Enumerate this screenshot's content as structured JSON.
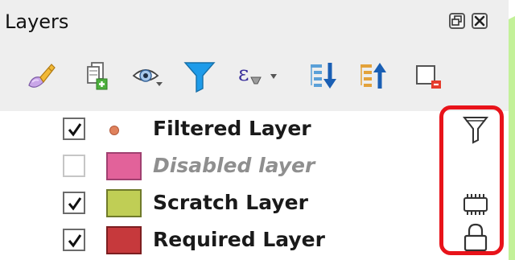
{
  "panel": {
    "title": "Layers",
    "title_buttons": [
      {
        "name": "float-button",
        "icon": "float-icon"
      },
      {
        "name": "close-button",
        "icon": "close-icon"
      }
    ]
  },
  "toolbar": {
    "tools": [
      {
        "name": "style-manager-button",
        "icon": "paintbrush-icon"
      },
      {
        "name": "add-group-button",
        "icon": "add-group-icon"
      },
      {
        "name": "visibility-button",
        "icon": "eye-icon"
      },
      {
        "name": "filter-legend-button",
        "icon": "filter-icon"
      },
      {
        "name": "filter-expression-button",
        "icon": "expression-icon"
      },
      {
        "name": "expand-all-button",
        "icon": "expand-all-icon"
      },
      {
        "name": "collapse-all-button",
        "icon": "collapse-all-icon"
      },
      {
        "name": "remove-layer-button",
        "icon": "remove-layer-icon"
      }
    ]
  },
  "layers": [
    {
      "name": "Filtered Layer",
      "checked": true,
      "symbol": "point",
      "symbol_color": "#e0825c",
      "indicator": "filter-icon",
      "disabled": false
    },
    {
      "name": "Disabled layer",
      "checked": false,
      "symbol": "fill",
      "symbol_color": "#e2629a",
      "indicator": "",
      "disabled": true
    },
    {
      "name": "Scratch Layer",
      "checked": true,
      "symbol": "fill",
      "symbol_color": "#c0ce55",
      "indicator": "memory-icon",
      "disabled": false
    },
    {
      "name": "Required Layer",
      "checked": true,
      "symbol": "fill",
      "symbol_color": "#c6393c",
      "indicator": "lock-icon",
      "disabled": false
    }
  ],
  "colors": {
    "callout": "#e8131a",
    "background_accent": "#b7e986",
    "panel_header": "#eeeeee"
  }
}
